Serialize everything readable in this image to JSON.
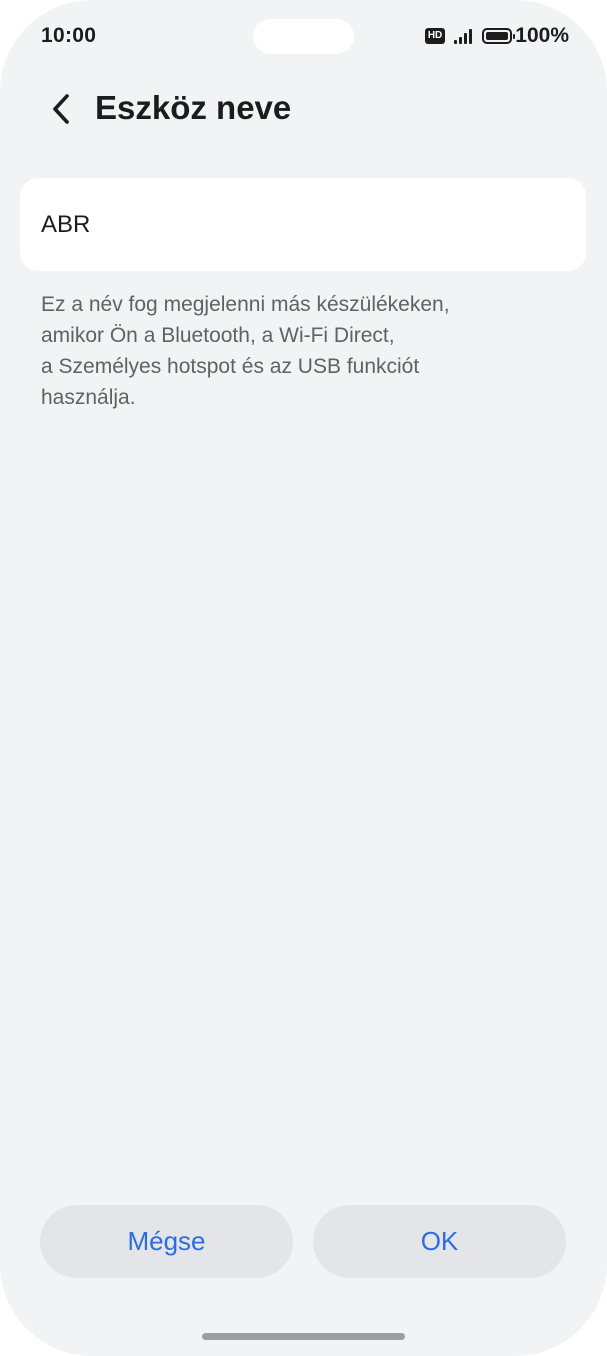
{
  "status_bar": {
    "time": "10:00",
    "network_badge": "HD",
    "battery": "100%",
    "icons": [
      "hd-icon",
      "signal-icon",
      "battery-icon"
    ]
  },
  "header": {
    "back_icon": "chevron-left-icon",
    "title": "Eszköz neve"
  },
  "name_field": {
    "value": "ABR"
  },
  "hint": {
    "lines": [
      "Ez a név fog megjelenni más készülékeken,",
      "amikor Ön a Bluetooth, a Wi-Fi Direct,",
      "a Személyes hotspot és az USB funkciót",
      "használja."
    ]
  },
  "actions": {
    "cancel_label": "Mégse",
    "ok_label": "OK"
  },
  "colors": {
    "background": "#f2f3f5",
    "card": "#ffffff",
    "accent": "#2d6ce0",
    "button_bg": "#e3e5e8",
    "hint_text": "#5f6165"
  }
}
